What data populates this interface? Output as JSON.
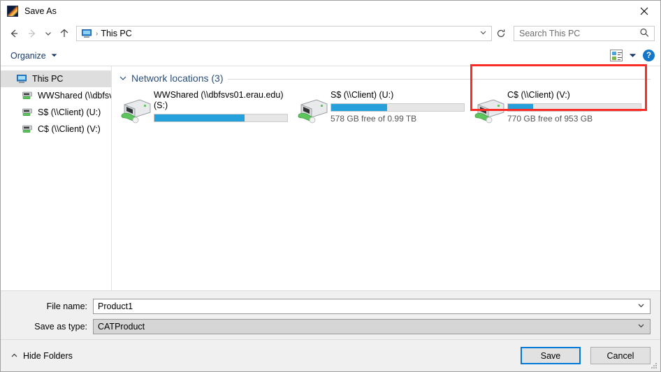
{
  "window": {
    "title": "Save As",
    "app_icon": "catia-app-icon",
    "close_label": "✕"
  },
  "nav": {
    "back_icon": "back-arrow-icon",
    "forward_icon": "forward-arrow-icon",
    "history_icon": "chevron-down-icon",
    "up_icon": "up-arrow-icon",
    "address_icon": "this-pc-icon",
    "address_separator": "›",
    "breadcrumb": "This PC",
    "address_chevron": "chevron-down-icon",
    "refresh_icon": "refresh-icon"
  },
  "search": {
    "placeholder": "Search This PC",
    "icon": "search-icon"
  },
  "toolbar": {
    "organize_label": "Organize",
    "organize_chevron": "chevron-down-icon",
    "view_icon": "view-options-icon",
    "view_chevron": "chevron-down-icon",
    "help_icon": "help-icon",
    "help_label": "?"
  },
  "sidebar": {
    "items": [
      {
        "label": "This PC",
        "icon": "this-pc-icon",
        "level": 0,
        "selected": true
      },
      {
        "label": "WWShared (\\\\dbfsv",
        "icon": "network-drive-icon",
        "level": 1,
        "selected": false
      },
      {
        "label": "S$ (\\\\Client) (U:)",
        "icon": "network-drive-icon",
        "level": 1,
        "selected": false
      },
      {
        "label": "C$ (\\\\Client) (V:)",
        "icon": "network-drive-icon",
        "level": 1,
        "selected": false
      }
    ]
  },
  "content": {
    "group": {
      "expand_icon": "chevron-down-icon",
      "title": "Network locations (3)"
    },
    "tiles": [
      {
        "name": "WWShared (\\\\dbfsvs01.erau.edu) (S:)",
        "icon": "network-drive-icon",
        "fill_percent": 68,
        "free_text": "",
        "highlighted": false
      },
      {
        "name": "S$ (\\\\Client) (U:)",
        "icon": "network-drive-icon",
        "fill_percent": 42,
        "free_text": "578 GB free of 0.99 TB",
        "highlighted": false
      },
      {
        "name": "C$ (\\\\Client) (V:)",
        "icon": "network-drive-icon",
        "fill_percent": 19,
        "free_text": "770 GB free of 953 GB",
        "highlighted": true
      }
    ]
  },
  "annotation": {
    "color": "#fc2b26"
  },
  "form": {
    "file_name_label": "File name:",
    "file_name_value": "Product1",
    "file_name_chevron": "chevron-down-icon",
    "save_type_label": "Save as type:",
    "save_type_value": "CATProduct",
    "save_type_chevron": "chevron-down-icon"
  },
  "footer": {
    "hide_folders_icon": "chevron-up-icon",
    "hide_folders_label": "Hide Folders",
    "save_label": "Save",
    "cancel_label": "Cancel",
    "resize_grip": "resize-grip-icon"
  },
  "colors": {
    "accent_blue": "#26a0da",
    "focus_blue": "#0078d7",
    "group_title": "#2a4f7c",
    "annotation_red": "#fc2b26"
  }
}
